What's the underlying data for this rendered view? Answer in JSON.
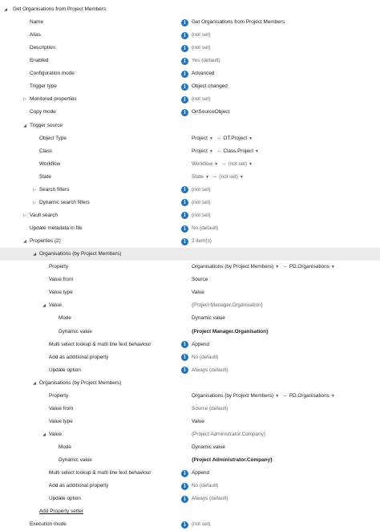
{
  "rows": [
    {
      "label": "Get Organisations from Project Members",
      "indent": 0,
      "toggle": "expanded",
      "value": null,
      "info": false
    },
    {
      "label": "Name",
      "indent": 1,
      "value": "Get Organisations from Project Members",
      "info": true
    },
    {
      "label": "Alias",
      "indent": 1,
      "value": "(not set)",
      "info": true,
      "muted": true
    },
    {
      "label": "Description",
      "indent": 1,
      "value": "(not set)",
      "info": true,
      "muted": true
    },
    {
      "label": "Enabled",
      "indent": 1,
      "value": "Yes (default)",
      "info": true,
      "muted": true
    },
    {
      "label": "Configuration mode",
      "indent": 1,
      "value": "Advanced",
      "info": true
    },
    {
      "label": "Trigger type",
      "indent": 1,
      "value": "Object changed",
      "info": true
    },
    {
      "label": "Monitored properties",
      "indent": 1,
      "toggle": "collapsed",
      "value": "(not set)",
      "info": true,
      "muted": true
    },
    {
      "label": "Copy mode",
      "indent": 1,
      "value": "OnSourceObject",
      "info": true
    },
    {
      "label": "Trigger source",
      "indent": 1,
      "toggle": "expanded",
      "value": null,
      "info": false
    },
    {
      "label": "Object Type",
      "indent": 2,
      "value": null,
      "info": false,
      "combo": [
        "Project",
        "OT.Project"
      ]
    },
    {
      "label": "Class",
      "indent": 2,
      "value": null,
      "info": false,
      "combo": [
        "Project",
        "Class.Project"
      ]
    },
    {
      "label": "Workflow",
      "indent": 2,
      "value": null,
      "info": false,
      "combo": [
        "Workflow",
        "(not set)"
      ],
      "muted": true
    },
    {
      "label": "State",
      "indent": 2,
      "value": null,
      "info": false,
      "combo": [
        "State",
        "(not set)"
      ],
      "muted": true
    },
    {
      "label": "Search filters",
      "indent": 2,
      "toggle": "collapsed",
      "value": "(not set)",
      "info": true,
      "muted": true
    },
    {
      "label": "Dynamic search filters",
      "indent": 2,
      "toggle": "collapsed",
      "value": "(not set)",
      "info": true,
      "muted": true
    },
    {
      "label": "Vault search",
      "indent": 1,
      "toggle": "collapsed",
      "value": "(not set)",
      "info": true,
      "muted": true
    },
    {
      "label": "Update metadata in file",
      "indent": 1,
      "value": "No (default)",
      "info": true,
      "muted": true
    },
    {
      "label": "Properties (2)",
      "indent": 1,
      "toggle": "expanded",
      "value": "2 item(s)",
      "info": true,
      "muted": true
    },
    {
      "label": "Organisations (by Project Members)",
      "indent": 2,
      "toggle": "expanded",
      "value": null,
      "info": false,
      "highlight": true
    },
    {
      "label": "Property",
      "indent": 3,
      "value": null,
      "info": false,
      "combo": [
        "Organisations (by Project Members)",
        "PD.Organisations"
      ]
    },
    {
      "label": "Value from",
      "indent": 3,
      "value": "Source",
      "info": false
    },
    {
      "label": "Value type",
      "indent": 3,
      "value": "Value",
      "info": false
    },
    {
      "label": "Value",
      "indent": 3,
      "toggle": "expanded",
      "value": "{Project Manager.Organisation}",
      "info": false,
      "muted": true
    },
    {
      "label": "Mode",
      "indent": 4,
      "value": "Dynamic value",
      "info": false
    },
    {
      "label": "Dynamic value",
      "indent": 4,
      "value": "{Project Manager.Organisation}",
      "info": false,
      "bold": true
    },
    {
      "label": "Multi select lookup & multi line text behaviour",
      "indent": 3,
      "value": "Append",
      "info": true
    },
    {
      "label": "Add as additional property",
      "indent": 3,
      "value": "No (default)",
      "info": true,
      "muted": true
    },
    {
      "label": "Update option",
      "indent": 3,
      "value": "Always (default)",
      "info": true,
      "muted": true
    },
    {
      "label": "Organisations (by Project Members)",
      "indent": 2,
      "toggle": "expanded",
      "value": null,
      "info": false
    },
    {
      "label": "Property",
      "indent": 3,
      "value": null,
      "info": false,
      "combo": [
        "Organisations (by Project Members)",
        "PD.Organisations"
      ]
    },
    {
      "label": "Value from",
      "indent": 3,
      "value": "Source (default)",
      "info": false,
      "muted": true
    },
    {
      "label": "Value type",
      "indent": 3,
      "value": "Value",
      "info": false
    },
    {
      "label": "Value",
      "indent": 3,
      "toggle": "expanded",
      "value": "{Project Administrator.Company}",
      "info": false,
      "muted": true
    },
    {
      "label": "Mode",
      "indent": 4,
      "value": "Dynamic value",
      "info": false
    },
    {
      "label": "Dynamic value",
      "indent": 4,
      "value": "{Project Administrator.Company}",
      "info": false,
      "bold": true
    },
    {
      "label": "Multi select lookup & multi line text behaviour",
      "indent": 3,
      "value": "Append",
      "info": true
    },
    {
      "label": "Add as additional property",
      "indent": 3,
      "value": "No (default)",
      "info": true,
      "muted": true
    },
    {
      "label": "Update option",
      "indent": 3,
      "value": "Always (default)",
      "info": true,
      "muted": true
    },
    {
      "label": "Add Property setter",
      "indent": 2,
      "value": null,
      "info": false,
      "link": true
    },
    {
      "label": "Execution mode",
      "indent": 1,
      "value": "(not set)",
      "info": true,
      "muted": true
    }
  ],
  "icons": {
    "info": "info-icon",
    "expanded": "caret-down-icon",
    "collapsed": "caret-right-icon",
    "link": "link-icon",
    "dropdown": "dropdown-arrow-icon"
  },
  "glyphs": {
    "info": "i",
    "expanded": "◢",
    "collapsed": "▷",
    "link": "⇔",
    "dropdown": "▼"
  }
}
